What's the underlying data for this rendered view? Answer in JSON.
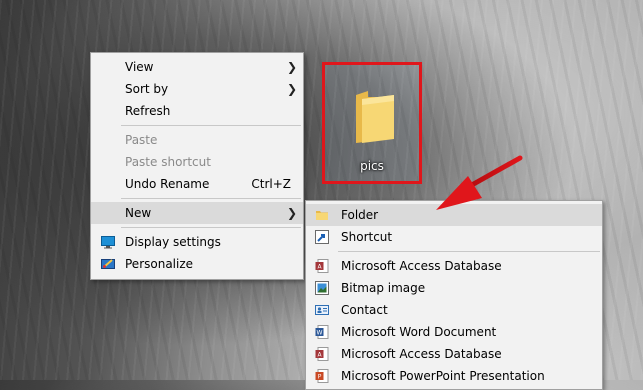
{
  "desktop": {
    "folder_label": "pics",
    "annotation_color": "#e0161b"
  },
  "context_menu": {
    "items": [
      {
        "label": "View",
        "submenu": true
      },
      {
        "label": "Sort by",
        "submenu": true
      },
      {
        "label": "Refresh"
      },
      {
        "label": "Paste",
        "disabled": true
      },
      {
        "label": "Paste shortcut",
        "disabled": true
      },
      {
        "label": "Undo Rename",
        "shortcut": "Ctrl+Z"
      },
      {
        "label": "New",
        "submenu": true,
        "highlighted": true
      },
      {
        "label": "Display settings",
        "icon": "display-icon"
      },
      {
        "label": "Personalize",
        "icon": "personalize-icon"
      }
    ]
  },
  "new_submenu": {
    "items": [
      {
        "label": "Folder",
        "icon": "folder-icon",
        "highlighted": true
      },
      {
        "label": "Shortcut",
        "icon": "shortcut-icon"
      },
      {
        "label": "Microsoft Access Database",
        "icon": "access-icon"
      },
      {
        "label": "Bitmap image",
        "icon": "bitmap-icon"
      },
      {
        "label": "Contact",
        "icon": "contact-icon"
      },
      {
        "label": "Microsoft Word Document",
        "icon": "word-icon"
      },
      {
        "label": "Microsoft Access Database",
        "icon": "access-icon"
      },
      {
        "label": "Microsoft PowerPoint Presentation",
        "icon": "powerpoint-icon"
      }
    ]
  }
}
